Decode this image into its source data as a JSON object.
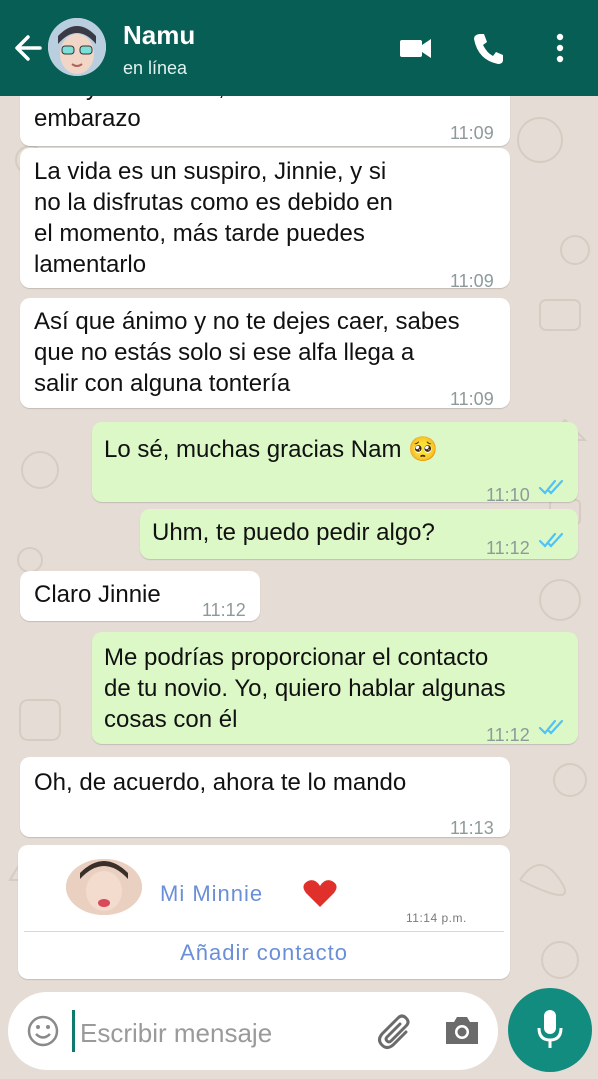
{
  "header": {
    "contact_name": "Namu",
    "status": "en línea",
    "icons": [
      "back-arrow-icon",
      "video-call-icon",
      "voice-call-icon",
      "more-options-icon"
    ]
  },
  "messages": [
    {
      "direction": "in",
      "text": "embarazo",
      "partial_top_line": "bien y sobre todo, disfrutar de tu",
      "time": "11:09"
    },
    {
      "direction": "in",
      "text": "La vida es un suspiro, Jinnie, y si\nno la disfrutas como es debido en\nel momento, más tarde puedes\nlamentarlo",
      "time": "11:09"
    },
    {
      "direction": "in",
      "text": "Así que ánimo y no te dejes caer, sabes\nque no estás solo si ese alfa llega a\nsalir con alguna tontería",
      "time": "11:09"
    },
    {
      "direction": "out",
      "text": "Lo sé, muchas gracias Nam 🥺",
      "time": "11:10",
      "status": "read"
    },
    {
      "direction": "out",
      "text": "Uhm, te puedo pedir algo?",
      "time": "11:12",
      "status": "read"
    },
    {
      "direction": "in",
      "text": "Claro Jinnie",
      "time": "11:12"
    },
    {
      "direction": "out",
      "text": "Me podrías proporcionar el contacto\nde tu novio. Yo, quiero hablar algunas\ncosas con él",
      "time": "11:12",
      "status": "read"
    },
    {
      "direction": "in",
      "text": "Oh, de acuerdo, ahora te lo mando",
      "time": "11:13"
    }
  ],
  "contact_card": {
    "name": "Mi Minnie",
    "emoji": "heart",
    "time": "11:14 p.m.",
    "action": "Añadir contacto"
  },
  "input": {
    "placeholder": "Escribir mensaje"
  },
  "colors": {
    "header": "#075e54",
    "outgoing_bubble": "#dcf8c6",
    "incoming_bubble": "#ffffff",
    "read_ticks": "#4fc3f7",
    "mic_button": "#128c7e",
    "link_text": "#6a8fd8"
  }
}
